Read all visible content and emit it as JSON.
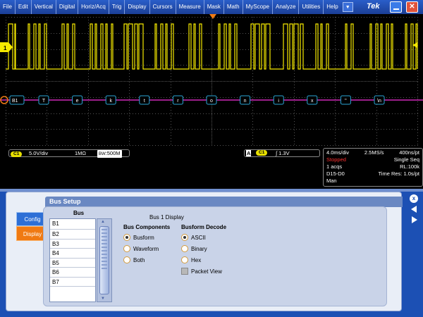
{
  "menu": {
    "items": [
      "File",
      "Edit",
      "Vertical",
      "Digital",
      "Horiz/Acq",
      "Trig",
      "Display",
      "Cursors",
      "Measure",
      "Mask",
      "Math",
      "MyScope",
      "Analyze",
      "Utilities",
      "Help"
    ],
    "dropdown_icon": "chevron-down-icon"
  },
  "brand": "Tek",
  "channel_marker": "1",
  "bus_marker": "B1",
  "decode_labels": [
    "T",
    "e",
    "k",
    "t",
    "r",
    "o",
    "n",
    "i",
    "x",
    "''",
    "\\n"
  ],
  "readouts": {
    "ch1_badge": "C1",
    "ch1_scale": "5.0V/div",
    "ch1_impedance": "1MΩ",
    "ch1_bandwidth": "500M",
    "trigger_source": "A",
    "trigger_channel": "C1",
    "trigger_level": "1.3V",
    "acq": {
      "timebase": "4.0ms/div",
      "sample_rate": "2.5MS/s",
      "resolution": "400ns/pt",
      "status": "Stopped",
      "mode": "Single Seq",
      "acqs": "1 acqs",
      "record_length": "RL:100k",
      "digital": "D15-D0",
      "time_res": "Time Res: 1.0s/pt",
      "trigger_mode": "Man"
    }
  },
  "bus_setup": {
    "title": "Bus Setup",
    "tabs": [
      "Config",
      "Display"
    ],
    "bus_heading": "Bus",
    "buses": [
      "B1",
      "B2",
      "B3",
      "B4",
      "B5",
      "B6",
      "B7"
    ],
    "display_heading": "Bus 1 Display",
    "components_heading": "Bus Components",
    "components": [
      "Busform",
      "Waveform",
      "Both"
    ],
    "components_selected": "Busform",
    "decode_heading": "Busform Decode",
    "decode": [
      "ASCII",
      "Binary",
      "Hex"
    ],
    "decode_selected": "ASCII",
    "packet_view": "Packet View"
  },
  "colors": {
    "trace": "#f5e900",
    "bus": "#2aa6d6",
    "menubar": "#2a5ec9",
    "accent_orange": "#f07a13"
  }
}
